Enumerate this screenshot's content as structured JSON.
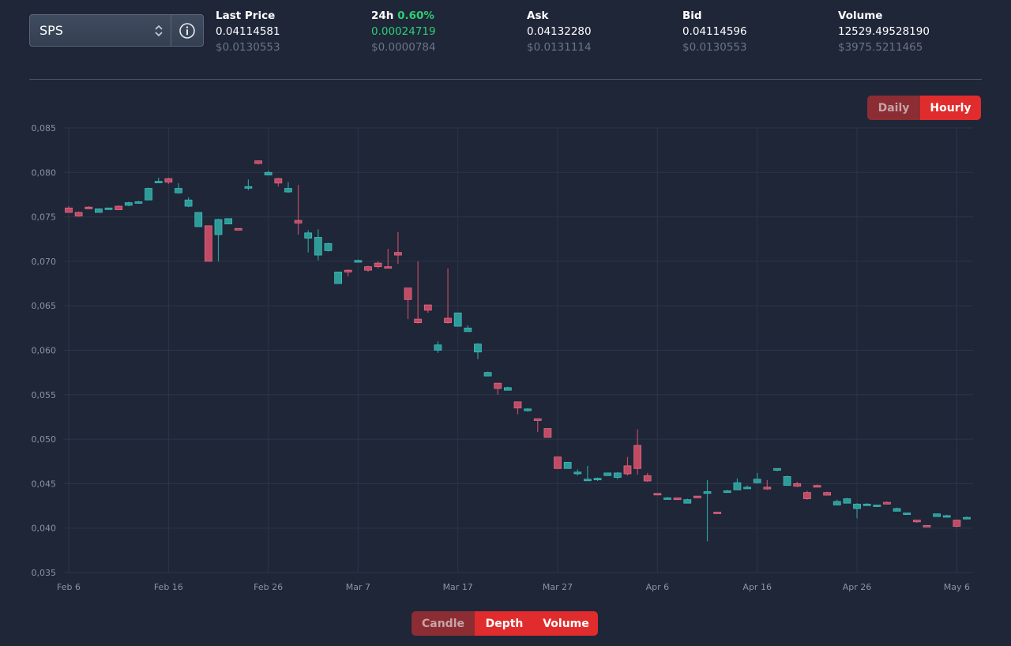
{
  "selector": {
    "value": "SPS"
  },
  "stats": {
    "last_price": {
      "label": "Last Price",
      "value": "0.04114581",
      "usd": "$0.0130553"
    },
    "change": {
      "label": "24h",
      "pct": "0.60%",
      "value": "0.00024719",
      "usd": "$0.0000784"
    },
    "ask": {
      "label": "Ask",
      "value": "0.04132280",
      "usd": "$0.0131114"
    },
    "bid": {
      "label": "Bid",
      "value": "0.04114596",
      "usd": "$0.0130553"
    },
    "volume": {
      "label": "Volume",
      "value": "12529.49528190",
      "usd": "$3975.5211465"
    }
  },
  "interval_toggle": {
    "daily": "Daily",
    "hourly": "Hourly",
    "selected": "Hourly"
  },
  "view_toggle": {
    "candle": "Candle",
    "depth": "Depth",
    "volume": "Volume"
  },
  "colors": {
    "up": "#2f9a98",
    "down": "#c24a63",
    "accent": "#e02c2c",
    "positive_text": "#2fce72"
  },
  "chart_data": {
    "type": "candlestick",
    "ylim": [
      0.035,
      0.085
    ],
    "ytick_labels": [
      "0,035",
      "0,040",
      "0,045",
      "0,050",
      "0,055",
      "0,060",
      "0,065",
      "0,070",
      "0,075",
      "0,080",
      "0,085"
    ],
    "xtick_labels": [
      "Feb 6",
      "Feb 16",
      "Feb 26",
      "Mar 7",
      "Mar 17",
      "Mar 27",
      "Apr 6",
      "Apr 16",
      "Apr 26",
      "May 6"
    ],
    "grid": true,
    "candles": [
      {
        "date": "Feb 6",
        "o": 0.076,
        "h": 0.0762,
        "l": 0.0755,
        "c": 0.0755
      },
      {
        "date": "Feb 7",
        "o": 0.0755,
        "h": 0.0756,
        "l": 0.075,
        "c": 0.0751
      },
      {
        "date": "Feb 8",
        "o": 0.0761,
        "h": 0.0762,
        "l": 0.0759,
        "c": 0.0759
      },
      {
        "date": "Feb 9",
        "o": 0.0755,
        "h": 0.0759,
        "l": 0.0755,
        "c": 0.0759
      },
      {
        "date": "Feb 10",
        "o": 0.0759,
        "h": 0.076,
        "l": 0.0758,
        "c": 0.076
      },
      {
        "date": "Feb 11",
        "o": 0.0762,
        "h": 0.0763,
        "l": 0.0758,
        "c": 0.0758
      },
      {
        "date": "Feb 12",
        "o": 0.0763,
        "h": 0.0767,
        "l": 0.0762,
        "c": 0.0766
      },
      {
        "date": "Feb 13",
        "o": 0.0766,
        "h": 0.0768,
        "l": 0.0765,
        "c": 0.0767
      },
      {
        "date": "Feb 14",
        "o": 0.0769,
        "h": 0.0783,
        "l": 0.0769,
        "c": 0.0782
      },
      {
        "date": "Feb 15",
        "o": 0.0789,
        "h": 0.0794,
        "l": 0.0788,
        "c": 0.079
      },
      {
        "date": "Feb 16",
        "o": 0.0793,
        "h": 0.0794,
        "l": 0.0787,
        "c": 0.0789
      },
      {
        "date": "Feb 17",
        "o": 0.0777,
        "h": 0.0788,
        "l": 0.0776,
        "c": 0.0782
      },
      {
        "date": "Feb 18",
        "o": 0.0762,
        "h": 0.0772,
        "l": 0.0761,
        "c": 0.0769
      },
      {
        "date": "Feb 19",
        "o": 0.0739,
        "h": 0.0755,
        "l": 0.0739,
        "c": 0.0755
      },
      {
        "date": "Feb 20",
        "o": 0.074,
        "h": 0.074,
        "l": 0.07,
        "c": 0.07
      },
      {
        "date": "Feb 21",
        "o": 0.073,
        "h": 0.0748,
        "l": 0.07,
        "c": 0.0747
      },
      {
        "date": "Feb 22",
        "o": 0.0742,
        "h": 0.0748,
        "l": 0.0742,
        "c": 0.0748
      },
      {
        "date": "Feb 23",
        "o": 0.0737,
        "h": 0.0737,
        "l": 0.0735,
        "c": 0.0735
      },
      {
        "date": "Feb 24",
        "o": 0.0783,
        "h": 0.0792,
        "l": 0.078,
        "c": 0.0784
      },
      {
        "date": "Feb 25",
        "o": 0.0813,
        "h": 0.0813,
        "l": 0.0809,
        "c": 0.081
      },
      {
        "date": "Feb 26",
        "o": 0.0797,
        "h": 0.0802,
        "l": 0.0797,
        "c": 0.08
      },
      {
        "date": "Feb 27",
        "o": 0.0793,
        "h": 0.0794,
        "l": 0.0784,
        "c": 0.0788
      },
      {
        "date": "Feb 28",
        "o": 0.0778,
        "h": 0.0789,
        "l": 0.0777,
        "c": 0.0782
      },
      {
        "date": "Mar 1",
        "o": 0.0746,
        "h": 0.0786,
        "l": 0.073,
        "c": 0.0743
      },
      {
        "date": "Mar 2",
        "o": 0.0726,
        "h": 0.0735,
        "l": 0.071,
        "c": 0.0732
      },
      {
        "date": "Mar 3",
        "o": 0.0707,
        "h": 0.0736,
        "l": 0.0701,
        "c": 0.0727
      },
      {
        "date": "Mar 4",
        "o": 0.0712,
        "h": 0.0721,
        "l": 0.0711,
        "c": 0.072
      },
      {
        "date": "Mar 5",
        "o": 0.0675,
        "h": 0.0688,
        "l": 0.0675,
        "c": 0.0688
      },
      {
        "date": "Mar 6",
        "o": 0.069,
        "h": 0.0691,
        "l": 0.0683,
        "c": 0.0688
      },
      {
        "date": "Mar 7",
        "o": 0.0699,
        "h": 0.0702,
        "l": 0.0699,
        "c": 0.0701
      },
      {
        "date": "Mar 8",
        "o": 0.0694,
        "h": 0.0695,
        "l": 0.0688,
        "c": 0.069
      },
      {
        "date": "Mar 9",
        "o": 0.0698,
        "h": 0.07,
        "l": 0.0692,
        "c": 0.0694
      },
      {
        "date": "Mar 10",
        "o": 0.0694,
        "h": 0.0714,
        "l": 0.0693,
        "c": 0.0693
      },
      {
        "date": "Mar 11",
        "o": 0.071,
        "h": 0.0733,
        "l": 0.0697,
        "c": 0.0707
      },
      {
        "date": "Mar 12",
        "o": 0.067,
        "h": 0.067,
        "l": 0.0635,
        "c": 0.0657
      },
      {
        "date": "Mar 13",
        "o": 0.0635,
        "h": 0.07,
        "l": 0.063,
        "c": 0.0631
      },
      {
        "date": "Mar 14",
        "o": 0.0651,
        "h": 0.0651,
        "l": 0.0642,
        "c": 0.0645
      },
      {
        "date": "Mar 15",
        "o": 0.06,
        "h": 0.061,
        "l": 0.0597,
        "c": 0.0606
      },
      {
        "date": "Mar 16",
        "o": 0.0636,
        "h": 0.0692,
        "l": 0.063,
        "c": 0.0631
      },
      {
        "date": "Mar 17",
        "o": 0.0627,
        "h": 0.0642,
        "l": 0.0627,
        "c": 0.0642
      },
      {
        "date": "Mar 18",
        "o": 0.0621,
        "h": 0.0628,
        "l": 0.0621,
        "c": 0.0625
      },
      {
        "date": "Mar 19",
        "o": 0.0598,
        "h": 0.0608,
        "l": 0.059,
        "c": 0.0607
      },
      {
        "date": "Mar 20",
        "o": 0.0571,
        "h": 0.0576,
        "l": 0.0571,
        "c": 0.0575
      },
      {
        "date": "Mar 21",
        "o": 0.0563,
        "h": 0.0563,
        "l": 0.055,
        "c": 0.0557
      },
      {
        "date": "Mar 22",
        "o": 0.0555,
        "h": 0.0559,
        "l": 0.0555,
        "c": 0.0558
      },
      {
        "date": "Mar 23",
        "o": 0.0542,
        "h": 0.0542,
        "l": 0.0528,
        "c": 0.0535
      },
      {
        "date": "Mar 24",
        "o": 0.0532,
        "h": 0.0535,
        "l": 0.0531,
        "c": 0.0534
      },
      {
        "date": "Mar 25",
        "o": 0.0523,
        "h": 0.0523,
        "l": 0.0508,
        "c": 0.0521
      },
      {
        "date": "Mar 26",
        "o": 0.0512,
        "h": 0.0512,
        "l": 0.0502,
        "c": 0.0502
      },
      {
        "date": "Mar 27",
        "o": 0.048,
        "h": 0.048,
        "l": 0.0467,
        "c": 0.0467
      },
      {
        "date": "Mar 28",
        "o": 0.0467,
        "h": 0.0474,
        "l": 0.0467,
        "c": 0.0474
      },
      {
        "date": "Mar 29",
        "o": 0.0461,
        "h": 0.0466,
        "l": 0.0459,
        "c": 0.0463
      },
      {
        "date": "Mar 30",
        "o": 0.0454,
        "h": 0.047,
        "l": 0.0453,
        "c": 0.0455
      },
      {
        "date": "Mar 31",
        "o": 0.0455,
        "h": 0.0457,
        "l": 0.0453,
        "c": 0.0456
      },
      {
        "date": "Apr 1",
        "o": 0.0459,
        "h": 0.0462,
        "l": 0.0459,
        "c": 0.0462
      },
      {
        "date": "Apr 2",
        "o": 0.0457,
        "h": 0.0463,
        "l": 0.0455,
        "c": 0.0462
      },
      {
        "date": "Apr 3",
        "o": 0.047,
        "h": 0.048,
        "l": 0.0459,
        "c": 0.0461
      },
      {
        "date": "Apr 4",
        "o": 0.0493,
        "h": 0.0511,
        "l": 0.046,
        "c": 0.0467
      },
      {
        "date": "Apr 5",
        "o": 0.0459,
        "h": 0.0462,
        "l": 0.0452,
        "c": 0.0453
      },
      {
        "date": "Apr 6",
        "o": 0.0439,
        "h": 0.0439,
        "l": 0.0438,
        "c": 0.0438
      },
      {
        "date": "Apr 7",
        "o": 0.0433,
        "h": 0.0435,
        "l": 0.0432,
        "c": 0.0434
      },
      {
        "date": "Apr 8",
        "o": 0.0434,
        "h": 0.0434,
        "l": 0.0432,
        "c": 0.0432
      },
      {
        "date": "Apr 9",
        "o": 0.0428,
        "h": 0.0433,
        "l": 0.0428,
        "c": 0.0432
      },
      {
        "date": "Apr 10",
        "o": 0.0436,
        "h": 0.0436,
        "l": 0.0434,
        "c": 0.0434
      },
      {
        "date": "Apr 11",
        "o": 0.0439,
        "h": 0.0454,
        "l": 0.0385,
        "c": 0.0441
      },
      {
        "date": "Apr 12",
        "o": 0.0418,
        "h": 0.0418,
        "l": 0.0417,
        "c": 0.0417
      },
      {
        "date": "Apr 13",
        "o": 0.044,
        "h": 0.0443,
        "l": 0.044,
        "c": 0.0442
      },
      {
        "date": "Apr 14",
        "o": 0.0443,
        "h": 0.0456,
        "l": 0.0443,
        "c": 0.0451
      },
      {
        "date": "Apr 15",
        "o": 0.0445,
        "h": 0.0448,
        "l": 0.0444,
        "c": 0.0446
      },
      {
        "date": "Apr 16",
        "o": 0.0451,
        "h": 0.0462,
        "l": 0.045,
        "c": 0.0455
      },
      {
        "date": "Apr 17",
        "o": 0.0446,
        "h": 0.0454,
        "l": 0.0443,
        "c": 0.0444
      },
      {
        "date": "Apr 18",
        "o": 0.0465,
        "h": 0.0467,
        "l": 0.0464,
        "c": 0.0467
      },
      {
        "date": "Apr 19",
        "o": 0.0448,
        "h": 0.0459,
        "l": 0.0448,
        "c": 0.0458
      },
      {
        "date": "Apr 20",
        "o": 0.045,
        "h": 0.0452,
        "l": 0.0446,
        "c": 0.0447
      },
      {
        "date": "Apr 21",
        "o": 0.044,
        "h": 0.0442,
        "l": 0.0432,
        "c": 0.0433
      },
      {
        "date": "Apr 22",
        "o": 0.0448,
        "h": 0.0449,
        "l": 0.0446,
        "c": 0.0446
      },
      {
        "date": "Apr 23",
        "o": 0.044,
        "h": 0.0441,
        "l": 0.0437,
        "c": 0.0437
      },
      {
        "date": "Apr 24",
        "o": 0.0426,
        "h": 0.0432,
        "l": 0.0426,
        "c": 0.043
      },
      {
        "date": "Apr 25",
        "o": 0.0428,
        "h": 0.0434,
        "l": 0.0428,
        "c": 0.0433
      },
      {
        "date": "Apr 26",
        "o": 0.0422,
        "h": 0.0428,
        "l": 0.0411,
        "c": 0.0427
      },
      {
        "date": "Apr 27",
        "o": 0.0426,
        "h": 0.0428,
        "l": 0.0426,
        "c": 0.0427
      },
      {
        "date": "Apr 28",
        "o": 0.0425,
        "h": 0.0426,
        "l": 0.0424,
        "c": 0.0426
      },
      {
        "date": "Apr 29",
        "o": 0.0429,
        "h": 0.043,
        "l": 0.0427,
        "c": 0.0427
      },
      {
        "date": "Apr 30",
        "o": 0.0419,
        "h": 0.0423,
        "l": 0.0419,
        "c": 0.0422
      },
      {
        "date": "May 1",
        "o": 0.0416,
        "h": 0.0417,
        "l": 0.0416,
        "c": 0.0417
      },
      {
        "date": "May 2",
        "o": 0.0409,
        "h": 0.0409,
        "l": 0.0406,
        "c": 0.0407
      },
      {
        "date": "May 3",
        "o": 0.0403,
        "h": 0.0403,
        "l": 0.0402,
        "c": 0.0402
      },
      {
        "date": "May 4",
        "o": 0.0413,
        "h": 0.0416,
        "l": 0.0413,
        "c": 0.0416
      },
      {
        "date": "May 5",
        "o": 0.0413,
        "h": 0.0415,
        "l": 0.0412,
        "c": 0.0414
      },
      {
        "date": "May 6",
        "o": 0.0409,
        "h": 0.0409,
        "l": 0.0401,
        "c": 0.0402
      },
      {
        "date": "May 7",
        "o": 0.0411,
        "h": 0.0413,
        "l": 0.0411,
        "c": 0.0412
      }
    ]
  }
}
